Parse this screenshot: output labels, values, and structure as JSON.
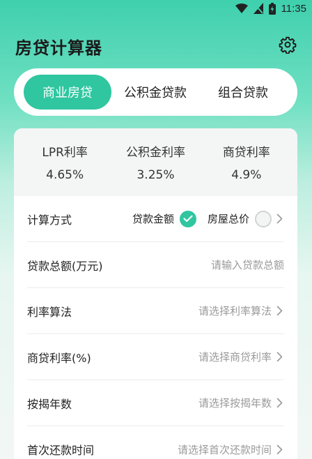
{
  "status_bar": {
    "time": "11:35"
  },
  "header": {
    "title": "房贷计算器"
  },
  "tabs": [
    {
      "label": "商业房贷",
      "active": true
    },
    {
      "label": "公积金贷款",
      "active": false
    },
    {
      "label": "组合贷款",
      "active": false
    }
  ],
  "rates": [
    {
      "label": "LPR利率",
      "value": "4.65%"
    },
    {
      "label": "公积金利率",
      "value": "3.25%"
    },
    {
      "label": "商贷利率",
      "value": "4.9%"
    }
  ],
  "form": {
    "method": {
      "label": "计算方式",
      "option_loan_amount": "贷款金额",
      "option_house_price": "房屋总价",
      "selected": "贷款金额"
    },
    "loan_total": {
      "label": "贷款总额(万元)",
      "placeholder": "请输入贷款总额"
    },
    "rate_method": {
      "label": "利率算法",
      "placeholder": "请选择利率算法"
    },
    "commercial_rate": {
      "label": "商贷利率(%)",
      "placeholder": "请选择商贷利率"
    },
    "years": {
      "label": "按揭年数",
      "placeholder": "请选择按揭年数"
    },
    "first_payment": {
      "label": "首次还款时间",
      "placeholder": "请选择首次还款时间"
    }
  },
  "colors": {
    "accent": "#2fc6a0",
    "background_top": "#3fd0ae"
  },
  "icons": {
    "wifi": "wifi-icon",
    "signal": "no-signal-icon",
    "battery": "battery-charging-icon",
    "settings": "gear-icon",
    "check": "check-icon",
    "chevron": "chevron-right-icon"
  }
}
